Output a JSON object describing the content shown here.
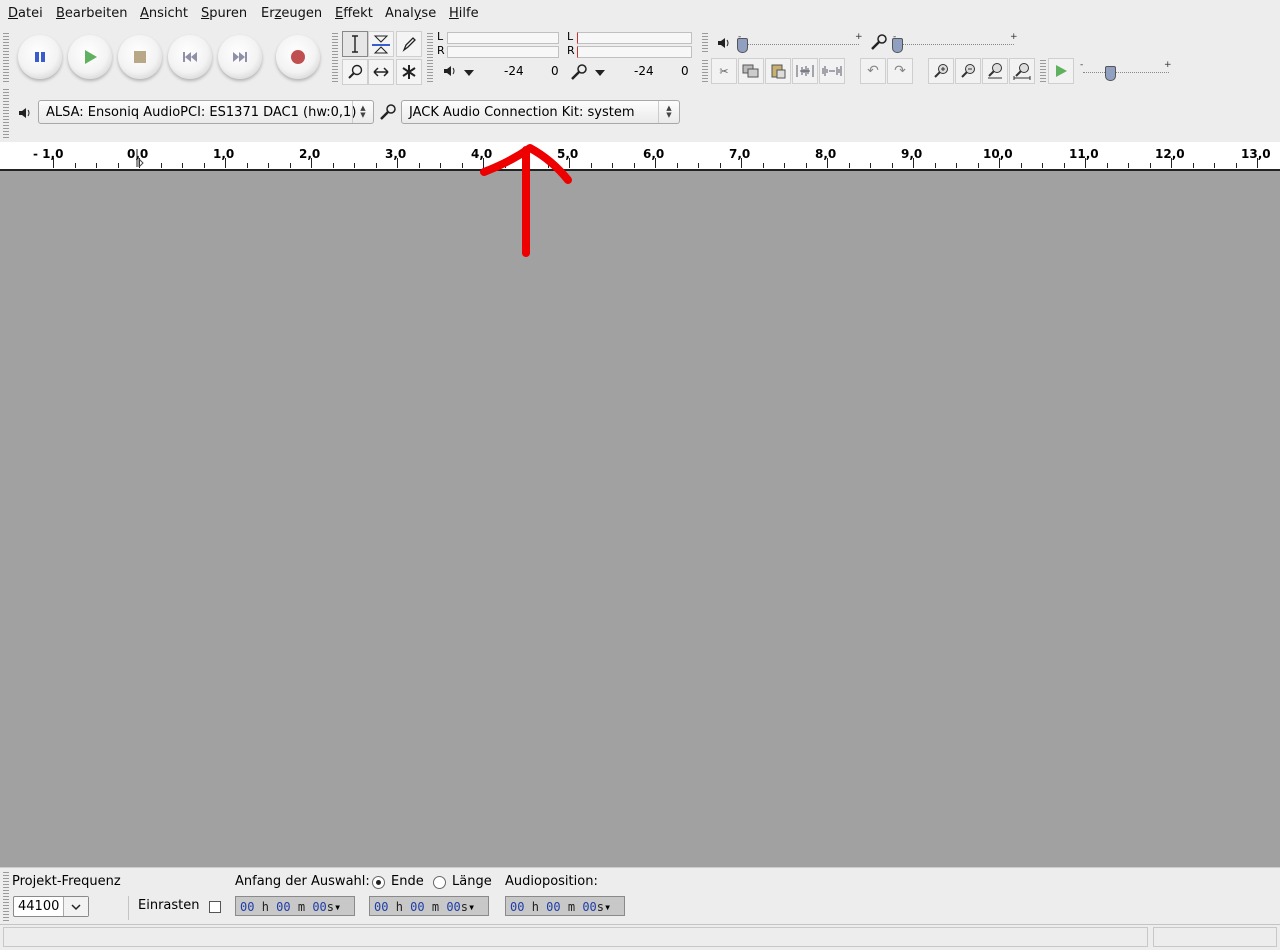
{
  "menubar": {
    "items": [
      {
        "pre": "",
        "key": "D",
        "post": "atei"
      },
      {
        "pre": "",
        "key": "B",
        "post": "earbeiten"
      },
      {
        "pre": "",
        "key": "A",
        "post": "nsicht"
      },
      {
        "pre": "",
        "key": "S",
        "post": "puren"
      },
      {
        "pre": "Er",
        "key": "z",
        "post": "eugen"
      },
      {
        "pre": "",
        "key": "E",
        "post": "ffekt"
      },
      {
        "pre": "Anal",
        "key": "y",
        "post": "se"
      },
      {
        "pre": "",
        "key": "H",
        "post": "ilfe"
      }
    ]
  },
  "transport": {
    "pause_icon": "pause-icon",
    "play_icon": "play-icon",
    "stop_icon": "stop-icon",
    "skip_start_icon": "skip-to-start-icon",
    "skip_end_icon": "skip-to-end-icon",
    "record_icon": "record-icon",
    "colors": {
      "pause": "#3a5ccc",
      "play": "#5fb05f",
      "stop": "#b8a888",
      "skip": "#9090a8",
      "record": "#c05050"
    }
  },
  "meters": {
    "playback": {
      "left": "L",
      "right": "R",
      "scale_a": "-24",
      "scale_b": "0"
    },
    "record": {
      "left": "L",
      "right": "R",
      "scale_a": "-24",
      "scale_b": "0"
    }
  },
  "mixer": {
    "minus": "-",
    "plus": "+",
    "playback_level": 0.0,
    "record_level": 0.0
  },
  "play_at_speed": {
    "minus": "-",
    "plus": "+",
    "speed_level": 0.5
  },
  "device": {
    "output": "ALSA: Ensoniq AudioPCI: ES1371 DAC1 (hw:0,1)",
    "input": "JACK Audio Connection Kit: system"
  },
  "ruler": {
    "labels": [
      "- 1,0",
      "0,0",
      "1,0",
      "2,0",
      "3,0",
      "4,0",
      "5,0",
      "6,0",
      "7,0",
      "8,0",
      "9,0",
      "10,0",
      "11,0",
      "12,0",
      "13,0"
    ]
  },
  "annotation": {
    "color": "#ee0000"
  },
  "selection": {
    "project_rate_label": "Projekt-Frequenz",
    "project_rate_value": "44100",
    "snap_label": "Einrasten",
    "start_label": "Anfang der Auswahl:",
    "end_label": "Ende",
    "length_label": "Länge",
    "position_label": "Audioposition:",
    "time_start": {
      "h": "00",
      "hu": "h",
      "m": "00",
      "mu": "m",
      "s": "00",
      "su": "s"
    },
    "time_end": {
      "h": "00",
      "hu": "h",
      "m": "00",
      "mu": "m",
      "s": "00",
      "su": "s"
    },
    "time_pos": {
      "h": "00",
      "hu": "h",
      "m": "00",
      "mu": "m",
      "s": "00",
      "su": "s"
    }
  }
}
